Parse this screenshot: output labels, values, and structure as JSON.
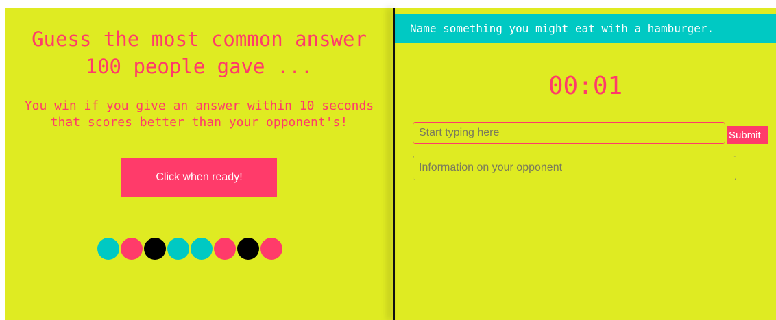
{
  "intro": {
    "title": "Guess the most common answer 100 people gave ...",
    "rules": "You win if you give an answer within 10 seconds that scores better than your opponent's!",
    "ready_button": "Click when ready!",
    "dot_colors": [
      "#00c9c3",
      "#ff3b6a",
      "#000000",
      "#00c9c3",
      "#00c9c3",
      "#ff3b6a",
      "#000000",
      "#ff3b6a"
    ]
  },
  "game": {
    "question": "Name something you might eat with a hamburger.",
    "timer": "00:01",
    "answer_placeholder": "Start typing here",
    "submit_label": "Submit",
    "opponent_info": "Information on your opponent"
  },
  "colors": {
    "background": "#dfeb22",
    "accent_pink": "#ff3b6a",
    "accent_teal": "#00c9c3"
  }
}
